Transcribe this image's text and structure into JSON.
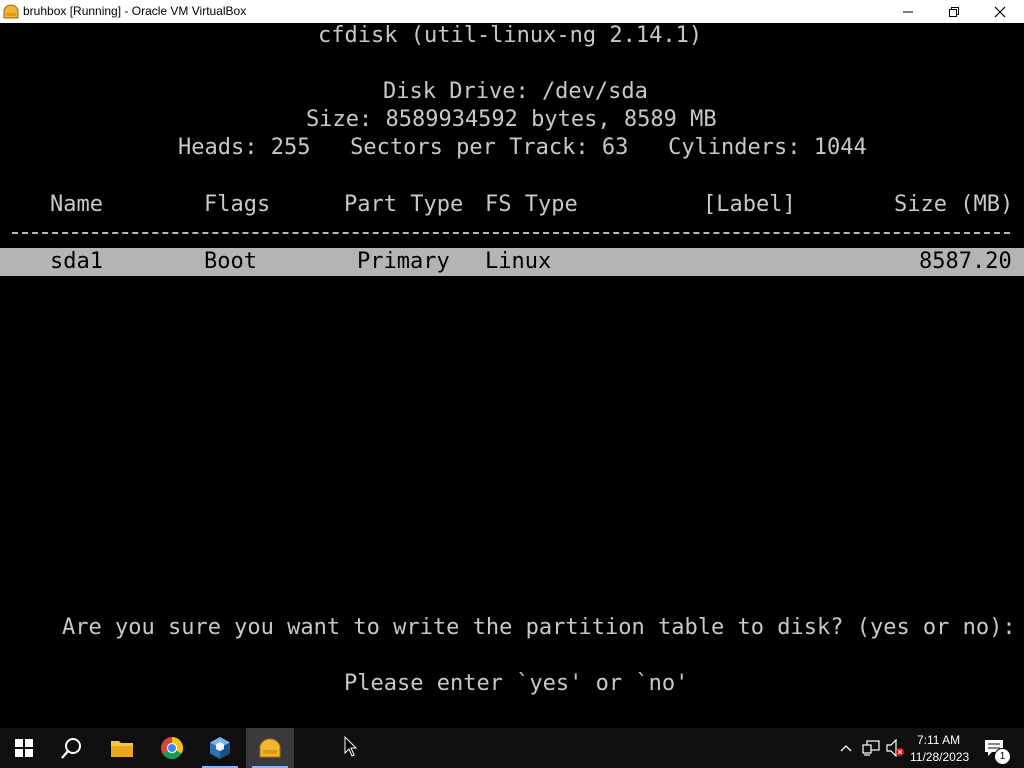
{
  "window": {
    "title": "bruhbox [Running] - Oracle VM VirtualBox"
  },
  "console": {
    "header": "cfdisk (util-linux-ng 2.14.1)",
    "disk_drive": "Disk Drive: /dev/sda",
    "size_line": "Size: 8589934592 bytes, 8589 MB",
    "geometry": "Heads: 255   Sectors per Track: 63   Cylinders: 1044",
    "columns": {
      "name": "Name",
      "flags": "Flags",
      "part_type": "Part Type",
      "fs_type": "FS Type",
      "label": "[Label]",
      "size": "Size (MB)"
    },
    "partitions": [
      {
        "name": "sda1",
        "flags": "Boot",
        "part_type": "Primary",
        "fs_type": "Linux",
        "label": "",
        "size": "8587.20"
      }
    ],
    "prompt": "Are you sure you want to write the partition table to disk? (yes or no): y",
    "message": "Please enter `yes' or `no'"
  },
  "taskbar": {
    "apps": [
      "start",
      "search",
      "file-explorer",
      "chrome",
      "virtualbox-manager",
      "virtualbox-vm"
    ],
    "clock": {
      "time": "7:11 AM",
      "date": "11/28/2023"
    },
    "notification_count": "1"
  },
  "colors": {
    "console_bg": "#000000",
    "console_text": "#c8c8c8",
    "highlight_bg": "#b4b4b4",
    "taskbar_bg": "#0f0f10",
    "titlebar_bg": "#ffffff"
  }
}
